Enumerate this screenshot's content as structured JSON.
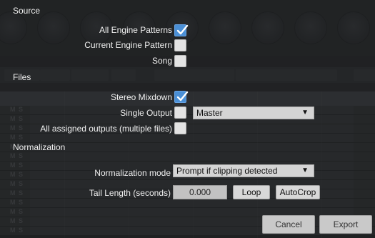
{
  "sections": {
    "source": "Source",
    "files": "Files",
    "normalization": "Normalization"
  },
  "source": {
    "all_engine_patterns": {
      "label": "All Engine Patterns",
      "checked": true
    },
    "current_engine_pattern": {
      "label": "Current Engine Pattern",
      "checked": false
    },
    "song": {
      "label": "Song",
      "checked": false
    }
  },
  "files": {
    "stereo_mixdown": {
      "label": "Stereo Mixdown",
      "checked": true
    },
    "single_output": {
      "label": "Single Output",
      "checked": false,
      "select_value": "Master"
    },
    "all_assigned_outputs": {
      "label": "All assigned outputs (multiple files)",
      "checked": false
    }
  },
  "normalization": {
    "mode_label": "Normalization mode",
    "mode_value": "Prompt if clipping detected",
    "tail_label": "Tail Length (seconds)",
    "tail_value": "0.000",
    "loop_button": "Loop",
    "autocrop_button": "AutoCrop"
  },
  "footer": {
    "cancel_button": "Cancel",
    "export_button": "Export"
  },
  "colors": {
    "checkbox_checked": "#4a8fd6",
    "checkbox_unchecked": "#e3e3e3",
    "overlay": "#1c1d1f"
  }
}
